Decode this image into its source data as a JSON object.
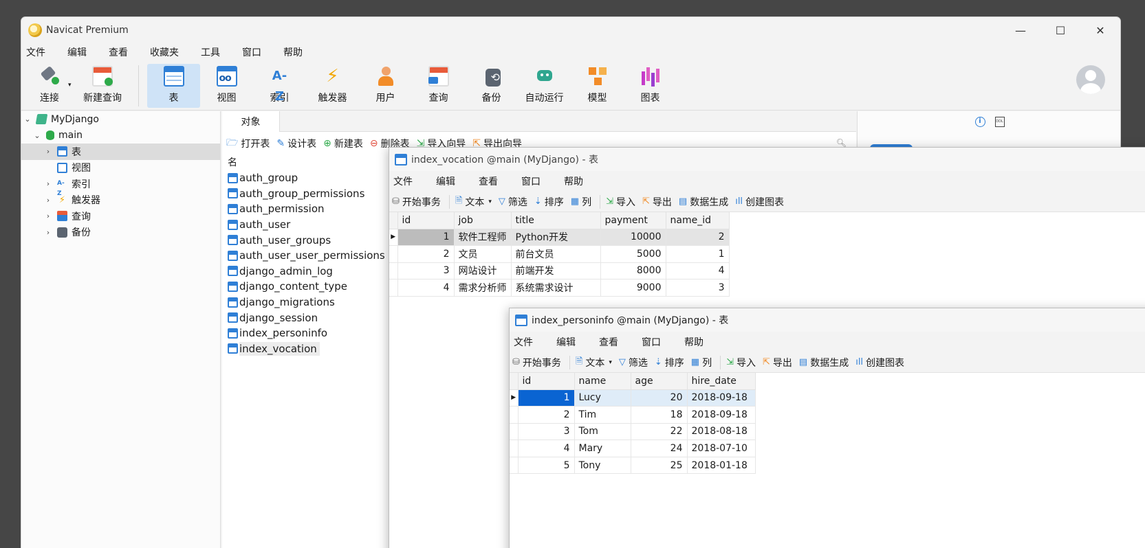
{
  "app": {
    "title": "Navicat Premium"
  },
  "window_controls": {
    "minimize": "—",
    "maximize": "☐",
    "close": "✕"
  },
  "menubar": [
    "文件",
    "编辑",
    "查看",
    "收藏夹",
    "工具",
    "窗口",
    "帮助"
  ],
  "ribbon": {
    "connect": "连接",
    "new_query": "新建查询",
    "buttons": [
      {
        "label": "表",
        "icon": "table-icon"
      },
      {
        "label": "视图",
        "icon": "view-icon"
      },
      {
        "label": "索引",
        "icon": "index-icon",
        "glyph": "A-Z"
      },
      {
        "label": "触发器",
        "icon": "trigger-icon",
        "glyph": "⚡"
      },
      {
        "label": "用户",
        "icon": "user-icon"
      },
      {
        "label": "查询",
        "icon": "query-icon"
      },
      {
        "label": "备份",
        "icon": "backup-icon"
      },
      {
        "label": "自动运行",
        "icon": "automation-icon"
      },
      {
        "label": "模型",
        "icon": "model-icon"
      },
      {
        "label": "图表",
        "icon": "chart-icon"
      }
    ],
    "active": "表"
  },
  "nav": {
    "connection": "MyDjango",
    "database": "main",
    "children": [
      "表",
      "视图",
      "索引",
      "触发器",
      "查询",
      "备份"
    ],
    "index_glyph": "A-Z",
    "trigger_glyph": "⚡"
  },
  "objects": {
    "tab": "对象",
    "toolbar": [
      "打开表",
      "设计表",
      "新建表",
      "删除表",
      "导入向导",
      "导出向导"
    ],
    "column_header": "名",
    "tables": [
      "auth_group",
      "auth_group_permissions",
      "auth_permission",
      "auth_user",
      "auth_user_groups",
      "auth_user_user_permissions",
      "django_admin_log",
      "django_content_type",
      "django_migrations",
      "django_session",
      "index_personinfo",
      "index_vocation"
    ],
    "selected": "index_vocation"
  },
  "info_panel": {
    "ddl_label": "DDL"
  },
  "window_vocation": {
    "title": "index_vocation @main (MyDjango) - 表",
    "menu": [
      "文件",
      "编辑",
      "查看",
      "窗口",
      "帮助"
    ],
    "tools": [
      "开始事务",
      "文本",
      "筛选",
      "排序",
      "列",
      "导入",
      "导出",
      "数据生成",
      "创建图表"
    ],
    "columns": [
      "id",
      "job",
      "title",
      "payment",
      "name_id"
    ],
    "rows": [
      [
        "1",
        "软件工程师",
        "Python开发",
        "10000",
        "2"
      ],
      [
        "2",
        "文员",
        "前台文员",
        "5000",
        "1"
      ],
      [
        "3",
        "网站设计",
        "前端开发",
        "8000",
        "4"
      ],
      [
        "4",
        "需求分析师",
        "系统需求设计",
        "9000",
        "3"
      ]
    ]
  },
  "window_personinfo": {
    "title": "index_personinfo @main (MyDjango) - 表",
    "menu": [
      "文件",
      "编辑",
      "查看",
      "窗口",
      "帮助"
    ],
    "tools": [
      "开始事务",
      "文本",
      "筛选",
      "排序",
      "列",
      "导入",
      "导出",
      "数据生成",
      "创建图表"
    ],
    "columns": [
      "id",
      "name",
      "age",
      "hire_date"
    ],
    "rows": [
      [
        "1",
        "Lucy",
        "20",
        "2018-09-18"
      ],
      [
        "2",
        "Tim",
        "18",
        "2018-09-18"
      ],
      [
        "3",
        "Tom",
        "22",
        "2018-08-18"
      ],
      [
        "4",
        "Mary",
        "24",
        "2018-07-10"
      ],
      [
        "5",
        "Tony",
        "25",
        "2018-01-18"
      ]
    ]
  }
}
